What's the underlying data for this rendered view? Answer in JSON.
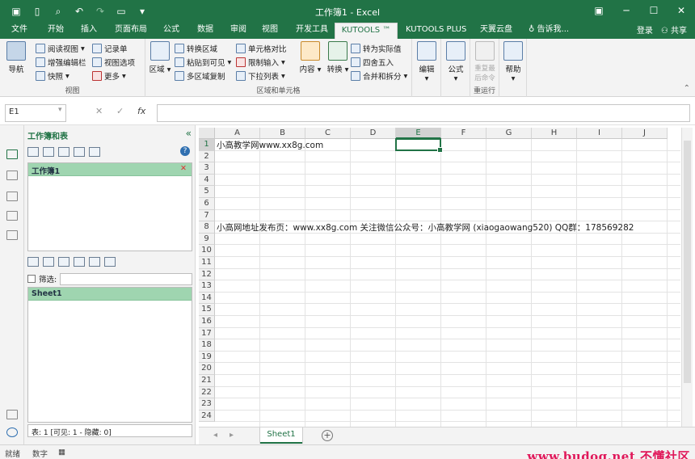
{
  "app": {
    "title": "工作簿1 - Excel",
    "colors": {
      "brand": "#217346",
      "selection": "#217346",
      "panel_highlight": "#9fd5b0"
    }
  },
  "qat": {
    "save_icon": "save-icon",
    "new_icon": "new-icon",
    "preview_icon": "print-preview-icon",
    "undo_icon": "undo-icon",
    "redo_icon": "redo-icon",
    "open_icon": "open-icon"
  },
  "window_buttons": {
    "restore_ribbon": "▣",
    "minimize": "─",
    "maximize": "☐",
    "close": "✕"
  },
  "tabs": [
    {
      "label": "文件"
    },
    {
      "label": "开始"
    },
    {
      "label": "插入"
    },
    {
      "label": "页面布局"
    },
    {
      "label": "公式"
    },
    {
      "label": "数据"
    },
    {
      "label": "审阅"
    },
    {
      "label": "视图"
    },
    {
      "label": "开发工具"
    },
    {
      "label": "KUTOOLS ™"
    },
    {
      "label": "KUTOOLS PLUS"
    },
    {
      "label": "天翼云盘"
    },
    {
      "label": "告诉我..."
    }
  ],
  "tabs_right": {
    "login": "登录",
    "share": "共享"
  },
  "ribbon": {
    "view_group": {
      "label": "视图",
      "nav": "导航",
      "items": [
        "阅读视图",
        "增强编辑栏",
        "快照",
        "记录单",
        "视图选项",
        "更多"
      ]
    },
    "range_group": {
      "label": "区域和单元格",
      "region": "区域",
      "items": [
        "转换区域",
        "粘贴到可见",
        "多区域复制",
        "单元格对比",
        "限制输入",
        "下拉列表"
      ],
      "content": "内容",
      "convert": "转换",
      "items2": [
        "转为实际值",
        "四舍五入",
        "合并和拆分"
      ]
    },
    "edit": "编辑",
    "formula": "公式",
    "rerun_group": {
      "label": "重运行",
      "button": "重复最后命令"
    },
    "help": "帮助"
  },
  "formula_bar": {
    "name_box": "E1",
    "cancel": "✕",
    "enter": "✓",
    "fx": "fx",
    "value": ""
  },
  "panel": {
    "title": "工作簿和表",
    "close": "«",
    "workbook": "工作簿1",
    "filter_label": "筛选:",
    "sheet": "Sheet1",
    "status": "表: 1  [可见: 1 - 隐藏: 0]"
  },
  "grid": {
    "columns": [
      "A",
      "B",
      "C",
      "D",
      "E",
      "F",
      "G",
      "H",
      "I",
      "J"
    ],
    "rows": [
      "1",
      "2",
      "3",
      "4",
      "5",
      "6",
      "7",
      "8",
      "9",
      "10",
      "11",
      "12",
      "13",
      "14",
      "15",
      "16",
      "17",
      "18",
      "19",
      "20",
      "21",
      "22",
      "23",
      "24"
    ],
    "cells": {
      "A1": "小高教学网www.xx8g.com",
      "A8": "小高网地址发布页：www.xx8g.com  关注微信公众号：小高教学网 (xiaogaowang520) QQ群：178569282"
    },
    "selected": "E1"
  },
  "sheet_tabs": {
    "active": "Sheet1",
    "add": "+"
  },
  "statusbar": {
    "ready": "就绪",
    "mode": "数字",
    "watermark": "www.budog.net 不懂社区"
  }
}
